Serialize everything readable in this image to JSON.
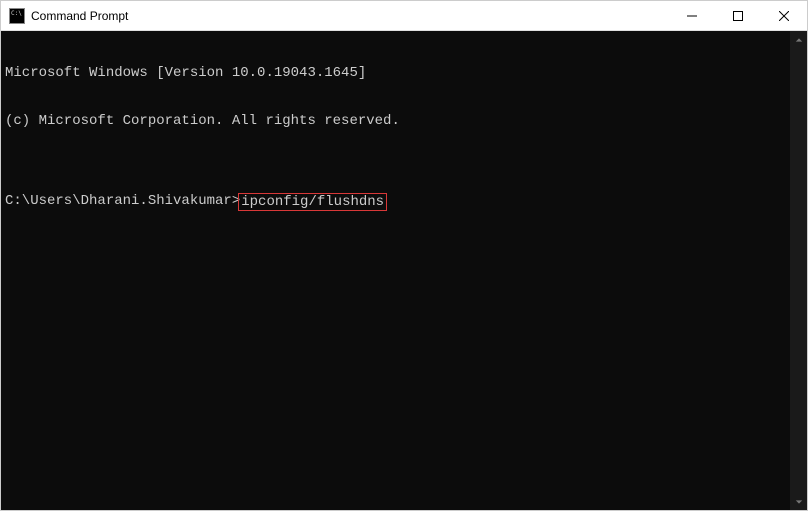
{
  "window": {
    "title": "Command Prompt"
  },
  "terminal": {
    "line1": "Microsoft Windows [Version 10.0.19043.1645]",
    "line2": "(c) Microsoft Corporation. All rights reserved.",
    "blank": "",
    "prompt": "C:\\Users\\Dharani.Shivakumar>",
    "command": "ipconfig/flushdns"
  }
}
